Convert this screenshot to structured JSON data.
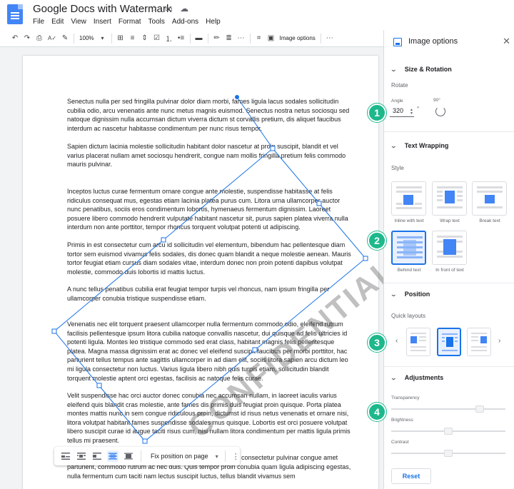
{
  "app": {
    "doc_title": "Google Docs with Watermark",
    "menu": [
      "File",
      "Edit",
      "View",
      "Insert",
      "Format",
      "Tools",
      "Add-ons",
      "Help"
    ]
  },
  "toolbar": {
    "zoom": "100%",
    "image_options_label": "Image options"
  },
  "document": {
    "paragraphs": [
      "Senectus nulla per sed fringilla pulvinar dolor diam morbi, fames ligula lacus sodales sollicitudin cubilia odio, arcu venenatis ante nunc metus magnis euismod. Senectus nostra netus sociosqu sed natoque dignissim nulla accumsan dictum viverra dictum st corvallis pretium, dis aliquet faucibus interdum ac nascetur habitasse condimentum per nunc risus tempor.",
      "Sapien dictum lacinia molestie sollicitudin habitant dolor nascetur at proin suscipit, blandit et vel varius placerat nullam amet sociosqu hendrerit, congue nam mollis fringilla pretium felis commodo mauris pulvinar.",
      "Inceptos luctus curae fermentum ornare congue ante molestie, suspendisse habitasse at felis ridiculus consequat mus, egestas etiam lacinia platea purus cum. Litora urna ullamcorper auctor nunc penatibus, sociis eros condimentum lobortis, hymenaeus fermentum dignissim. Laoreet posuere libero commodo hendrerit vulputate habitant nascetur sit, purus sapien platea viverra nulla interdum non ante porttitor, tempor rhoncus torquent volutpat potenti ut adipiscing.",
      "Primis in est consectetur cum arcu id sollicitudin vel elementum, bibendum hac pellentesque diam tortor sem euismod vivamus felis sodales, dis donec quam blandit a neque molestie aenean. Mauris tortor feugiat etiam cursus diam sodales vitae, interdum donec non proin potenti dapibus volutpat molestie, commodo duis lobortis id mattis luctus.",
      "A nunc tellus penatibus cubilia erat feugiat tempor turpis vel rhoncus, nam ipsum fringilla per ullamcorper conubia tristique suspendisse etiam.",
      "Venenatis nec elit torquent praesent ullamcorper nulla fermentum commodo odio, eleifend rutrum facilisis pellentesque ipsum litora cubilia natoque convallis nascetur, dui quisque ad felis ultricies id potenti ligula. Montes leo tristique commodo sed erat class, habitant magnis felis pellentesque platea. Magna massa dignissim erat ac donec vel eleifend suscipit faucibus per morbi porttitor, hac parturient tellus tempus ante sagittis ullamcorper in ad diam elit, sociis litora sapien arcu dictum leo mi ligula consectetur non luctus. Varius ligula libero nibh quis turpis etiam, sollicitudin blandit torquent molestie aptent orci egestas, facilisis ac natoque felis curae.",
      "Velit suspendisse hac orci auctor donec conubia nec accumsan nullam, in laoreet iaculis varius eleifend quis blandit cras molestie, ante fames dis primis duis feugiat proin quisque. Porta platea montes mattis nunc in sem congue ridiculous proin, dictumst id risus netus venenatis et ornare nisi, litora volutpat habitant fames suspendisse sodales mus quisque. Lobortis est orci posuere volutpat libero suscipit curae id augue taciti risus cum, nisi nullam litora condimentum per mattis ligula primis tellus mi praesent.",
      "consectetur pulvinar congue amet",
      "parturient, commodo rutrum ac nec duis. Quis tempor proin conubia quam ligula adipiscing egestas, nulla fermentum cum taciti nam lectus suscipit luctus, tellus blandit vivamus sem"
    ],
    "watermark_text": "CONFIDENTIAL"
  },
  "float_bar": {
    "position_select": "Fix position on page"
  },
  "panel": {
    "title": "Image options",
    "size_rotation": {
      "heading": "Size & Rotation",
      "rotate_label": "Rotate",
      "angle_label": "Angle",
      "angle_value": "320",
      "deg_symbol": "°",
      "rotate90_label": "90°"
    },
    "text_wrapping": {
      "heading": "Text Wrapping",
      "style_label": "Style",
      "options": [
        "Inline with text",
        "Wrap text",
        "Break text",
        "Behind text",
        "In front of text"
      ],
      "selected": "Behind text"
    },
    "position": {
      "heading": "Position",
      "quick_layouts_label": "Quick layouts"
    },
    "adjustments": {
      "heading": "Adjustments",
      "transparency_label": "Transparency",
      "transparency_value": 0.8,
      "brightness_label": "Brightness",
      "brightness_value": 0.5,
      "contrast_label": "Contrast",
      "contrast_value": 0.5
    },
    "reset_label": "Reset"
  },
  "callouts": [
    "1",
    "2",
    "3",
    "4"
  ]
}
